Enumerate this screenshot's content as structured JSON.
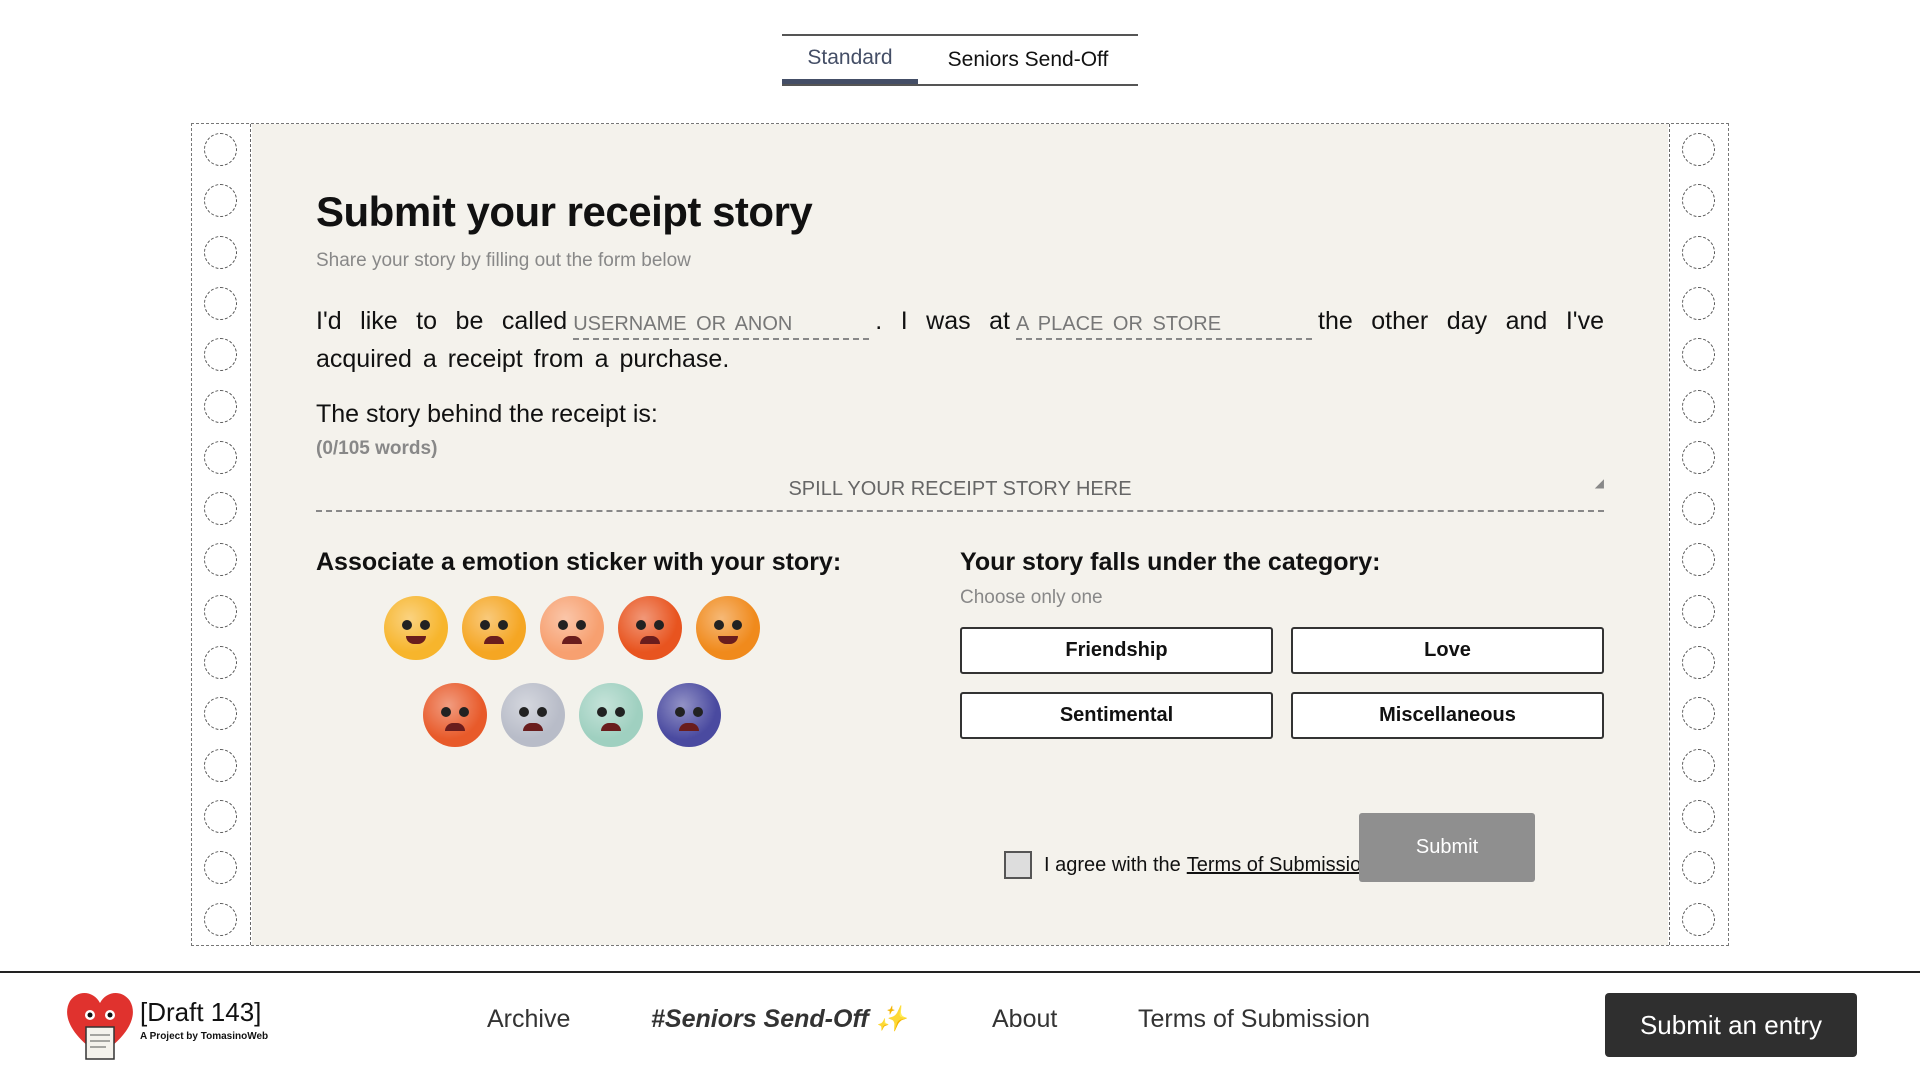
{
  "tabs": {
    "standard": "Standard",
    "seniors": "Seniors Send-Off"
  },
  "form": {
    "title": "Submit your receipt story",
    "subtitle": "Share your story by filling out the form below",
    "sentence_part1": "I'd like to be called",
    "username_placeholder": "USERNAME OR ANON",
    "sentence_part2": ". I was at",
    "place_placeholder": "A PLACE OR STORE",
    "sentence_part3": "the other day and I've acquired a receipt from a purchase.",
    "story_label": "The story behind the receipt is:",
    "word_count": "(0/105 words)",
    "story_placeholder": "SPILL YOUR RECEIPT STORY HERE",
    "emotion_label": "Associate a emotion sticker with your story:",
    "category_label": "Your story falls under the category:",
    "category_sub": "Choose only one",
    "categories": [
      "Friendship",
      "Love",
      "Sentimental",
      "Miscellaneous"
    ],
    "agree_text": "I agree with the",
    "terms_link": "Terms of Submission",
    "submit": "Submit"
  },
  "emotions": [
    {
      "name": "laughing",
      "color": "#f7b52c"
    },
    {
      "name": "smug",
      "color": "#f5a623"
    },
    {
      "name": "shocked",
      "color": "#f7a070"
    },
    {
      "name": "angry",
      "color": "#e8541f"
    },
    {
      "name": "yum",
      "color": "#f08a1c"
    },
    {
      "name": "furious",
      "color": "#e85a2a"
    },
    {
      "name": "unamused",
      "color": "#b8bcc8"
    },
    {
      "name": "skeptical",
      "color": "#9fd0c0"
    },
    {
      "name": "sad",
      "color": "#4a4aa0"
    }
  ],
  "footer": {
    "brand": "[Draft 143]",
    "brand_sub": "A Project by TomasinoWeb",
    "nav": [
      "Archive",
      "#Seniors Send-Off ✨",
      "About",
      "Terms of Submission"
    ],
    "cta": "Submit an entry"
  }
}
